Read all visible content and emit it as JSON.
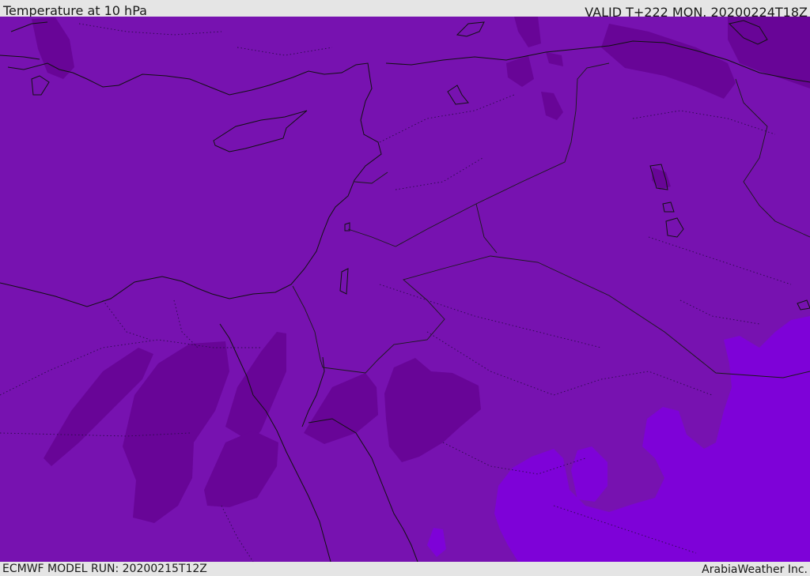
{
  "header": {
    "title": "Temperature at 10 hPa",
    "valid": "VALID T+222 MON. 20200224T18Z"
  },
  "footer": {
    "model_run": "ECMWF MODEL RUN: 20200215T12Z",
    "credit": "ArabiaWeather Inc."
  },
  "colors": {
    "base_field": "#7712b0",
    "cold_pocket": "#680597",
    "warm_pocket": "#7e02d8",
    "coastline": "#111111",
    "border": "#1a1a1a"
  }
}
